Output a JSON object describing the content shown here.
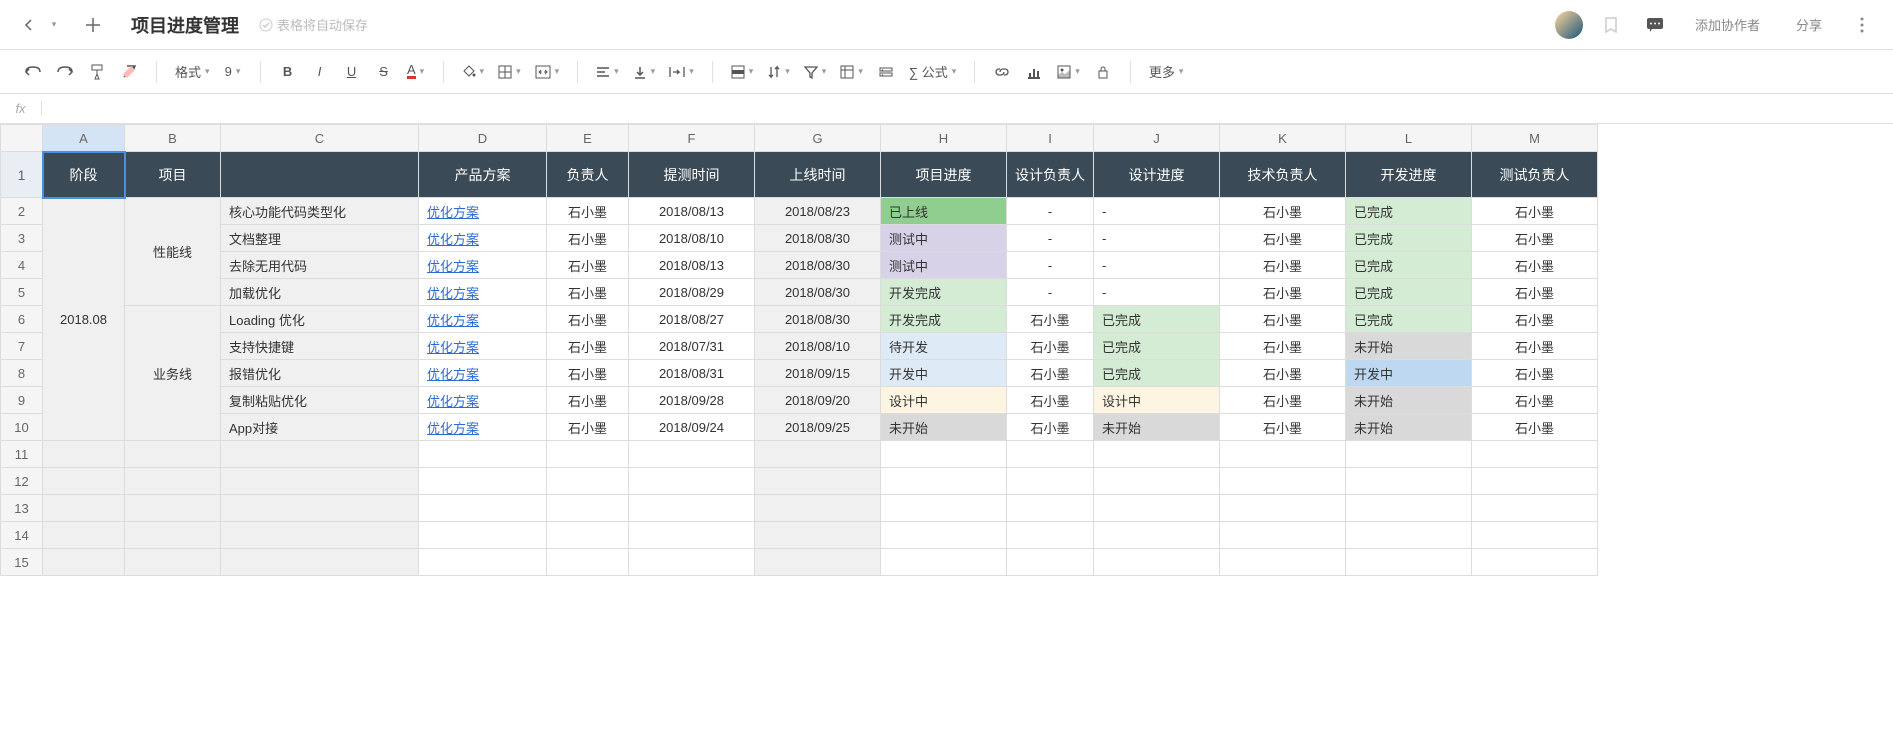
{
  "header": {
    "doc_title": "项目进度管理",
    "autosave": "表格将自动保存",
    "add_collab": "添加协作者",
    "share": "分享"
  },
  "toolbar": {
    "format": "格式",
    "font_size": "9",
    "formula": "∑ 公式",
    "more": "更多"
  },
  "columns": [
    "A",
    "B",
    "C",
    "D",
    "E",
    "F",
    "G",
    "H",
    "I",
    "J",
    "K",
    "L",
    "M"
  ],
  "headers": {
    "A": "阶段",
    "B": "项目",
    "C": "",
    "D": "产品方案",
    "E": "负责人",
    "F": "提测时间",
    "G": "上线时间",
    "H": "项目进度",
    "I": "设计负责人",
    "J": "设计进度",
    "K": "技术负责人",
    "L": "开发进度",
    "M": "测试负责人"
  },
  "merges": {
    "A": {
      "text": "2018.08",
      "rows": 9
    },
    "B1": {
      "text": "性能线",
      "rows": 4
    },
    "B2": {
      "text": "业务线",
      "rows": 5
    }
  },
  "link_label": "优化方案",
  "rows": [
    {
      "C": "核心功能代码类型化",
      "E": "石小墨",
      "F": "2018/08/13",
      "G": "2018/08/23",
      "H": "已上线",
      "H_cls": "bg-green-dark",
      "I": "-",
      "J": "-",
      "K": "石小墨",
      "L": "已完成",
      "L_cls": "bg-green-light",
      "M": "石小墨"
    },
    {
      "C": "文档整理",
      "E": "石小墨",
      "F": "2018/08/10",
      "G": "2018/08/30",
      "H": "测试中",
      "H_cls": "bg-purple",
      "I": "-",
      "J": "-",
      "K": "石小墨",
      "L": "已完成",
      "L_cls": "bg-green-light",
      "M": "石小墨"
    },
    {
      "C": "去除无用代码",
      "E": "石小墨",
      "F": "2018/08/13",
      "G": "2018/08/30",
      "H": "测试中",
      "H_cls": "bg-purple",
      "I": "-",
      "J": "-",
      "K": "石小墨",
      "L": "已完成",
      "L_cls": "bg-green-light",
      "M": "石小墨"
    },
    {
      "C": "加载优化",
      "E": "石小墨",
      "F": "2018/08/29",
      "G": "2018/08/30",
      "H": "开发完成",
      "H_cls": "bg-green-light",
      "I": "-",
      "J": "-",
      "K": "石小墨",
      "L": "已完成",
      "L_cls": "bg-green-light",
      "M": "石小墨"
    },
    {
      "C": "Loading 优化",
      "E": "石小墨",
      "F": "2018/08/27",
      "G": "2018/08/30",
      "H": "开发完成",
      "H_cls": "bg-green-light",
      "I": "石小墨",
      "J": "已完成",
      "J_cls": "bg-green-light",
      "K": "石小墨",
      "L": "已完成",
      "L_cls": "bg-green-light",
      "M": "石小墨"
    },
    {
      "C": "支持快捷键",
      "E": "石小墨",
      "F": "2018/07/31",
      "G": "2018/08/10",
      "H": "待开发",
      "H_cls": "bg-blue-light",
      "I": "石小墨",
      "J": "已完成",
      "J_cls": "bg-green-light",
      "K": "石小墨",
      "L": "未开始",
      "L_cls": "bg-gray",
      "M": "石小墨"
    },
    {
      "C": "报错优化",
      "E": "石小墨",
      "F": "2018/08/31",
      "G": "2018/09/15",
      "H": "开发中",
      "H_cls": "bg-blue-light",
      "I": "石小墨",
      "J": "已完成",
      "J_cls": "bg-green-light",
      "K": "石小墨",
      "L": "开发中",
      "L_cls": "bg-blue-mid",
      "M": "石小墨"
    },
    {
      "C": "复制粘贴优化",
      "E": "石小墨",
      "F": "2018/09/28",
      "G": "2018/09/20",
      "H": "设计中",
      "H_cls": "bg-cream",
      "I": "石小墨",
      "J": "设计中",
      "J_cls": "bg-cream",
      "K": "石小墨",
      "L": "未开始",
      "L_cls": "bg-gray",
      "M": "石小墨"
    },
    {
      "C": "App对接",
      "E": "石小墨",
      "F": "2018/09/24",
      "G": "2018/09/25",
      "H": "未开始",
      "H_cls": "bg-gray",
      "I": "石小墨",
      "J": "未开始",
      "J_cls": "bg-gray",
      "K": "石小墨",
      "L": "未开始",
      "L_cls": "bg-gray",
      "M": "石小墨"
    }
  ],
  "empty_rows": 5
}
